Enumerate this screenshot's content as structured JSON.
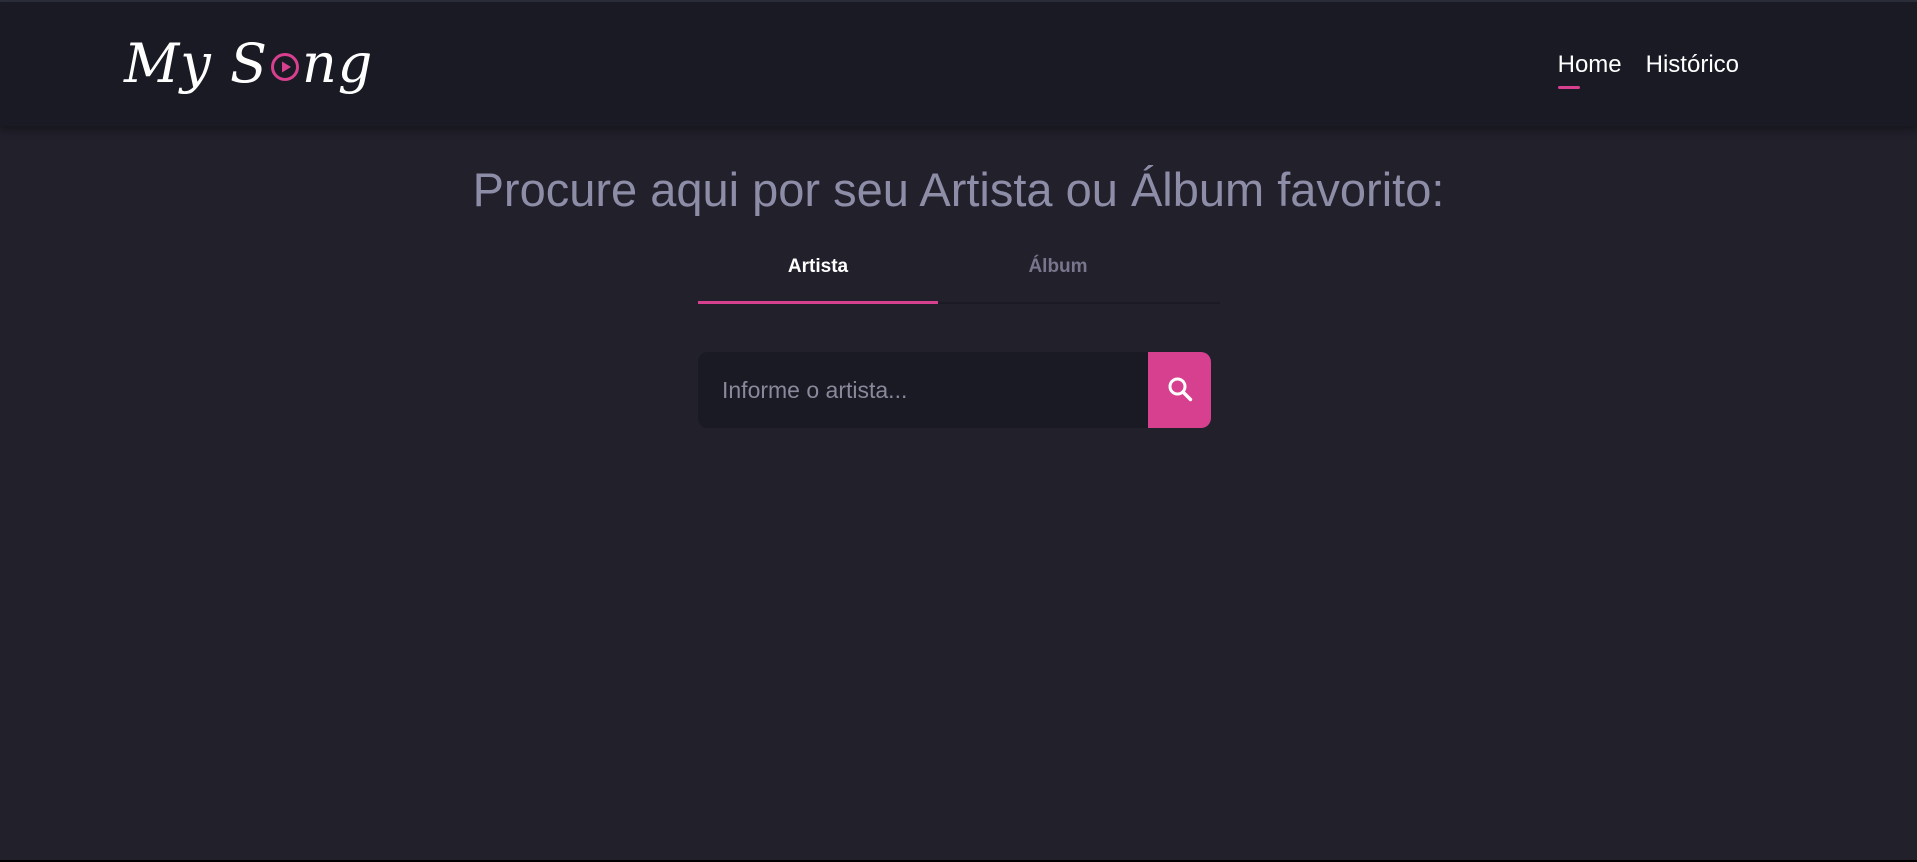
{
  "colors": {
    "background": "#21202b",
    "header": "#191a24",
    "accent": "#d6408e",
    "title": "#8e8da8"
  },
  "logo": {
    "text_before": "My S",
    "icon": "play-circle-icon",
    "text_after": "ng"
  },
  "nav": {
    "items": [
      {
        "label": "Home",
        "active": true
      },
      {
        "label": "Histórico",
        "active": false
      }
    ]
  },
  "main": {
    "title": "Procure aqui por seu Artista ou Álbum favorito:",
    "tabs": [
      {
        "label": "Artista",
        "active": true
      },
      {
        "label": "Álbum",
        "active": false
      }
    ],
    "search": {
      "placeholder": "Informe o artista...",
      "value": "",
      "button_icon": "search-icon"
    }
  }
}
